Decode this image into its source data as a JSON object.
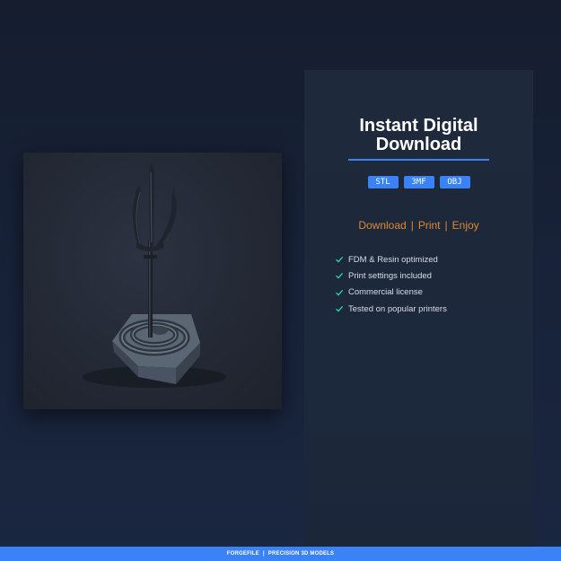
{
  "hero": {
    "image_subject": "trident-on-hexagonal-snake-base",
    "image_icon": "3d-model-render"
  },
  "panel": {
    "title_line1": "Instant Digital",
    "title_line2": "Download",
    "formats": [
      "STL",
      "3MF",
      "OBJ"
    ],
    "tagline": [
      "Download",
      "Print",
      "Enjoy"
    ],
    "features": [
      "FDM & Resin optimized",
      "Print settings included",
      "Commercial license",
      "Tested on popular printers"
    ],
    "check_icon": "checkmark-icon"
  },
  "footer": {
    "brand": "FORGEFILE",
    "separator": "|",
    "slogan": "PRECISION 3D MODELS"
  },
  "colors": {
    "accent": "#3b82f6",
    "tagline": "#e0882e",
    "check": "#2dd4bf",
    "background": "#161f30",
    "panel": "#1e2a3b"
  }
}
